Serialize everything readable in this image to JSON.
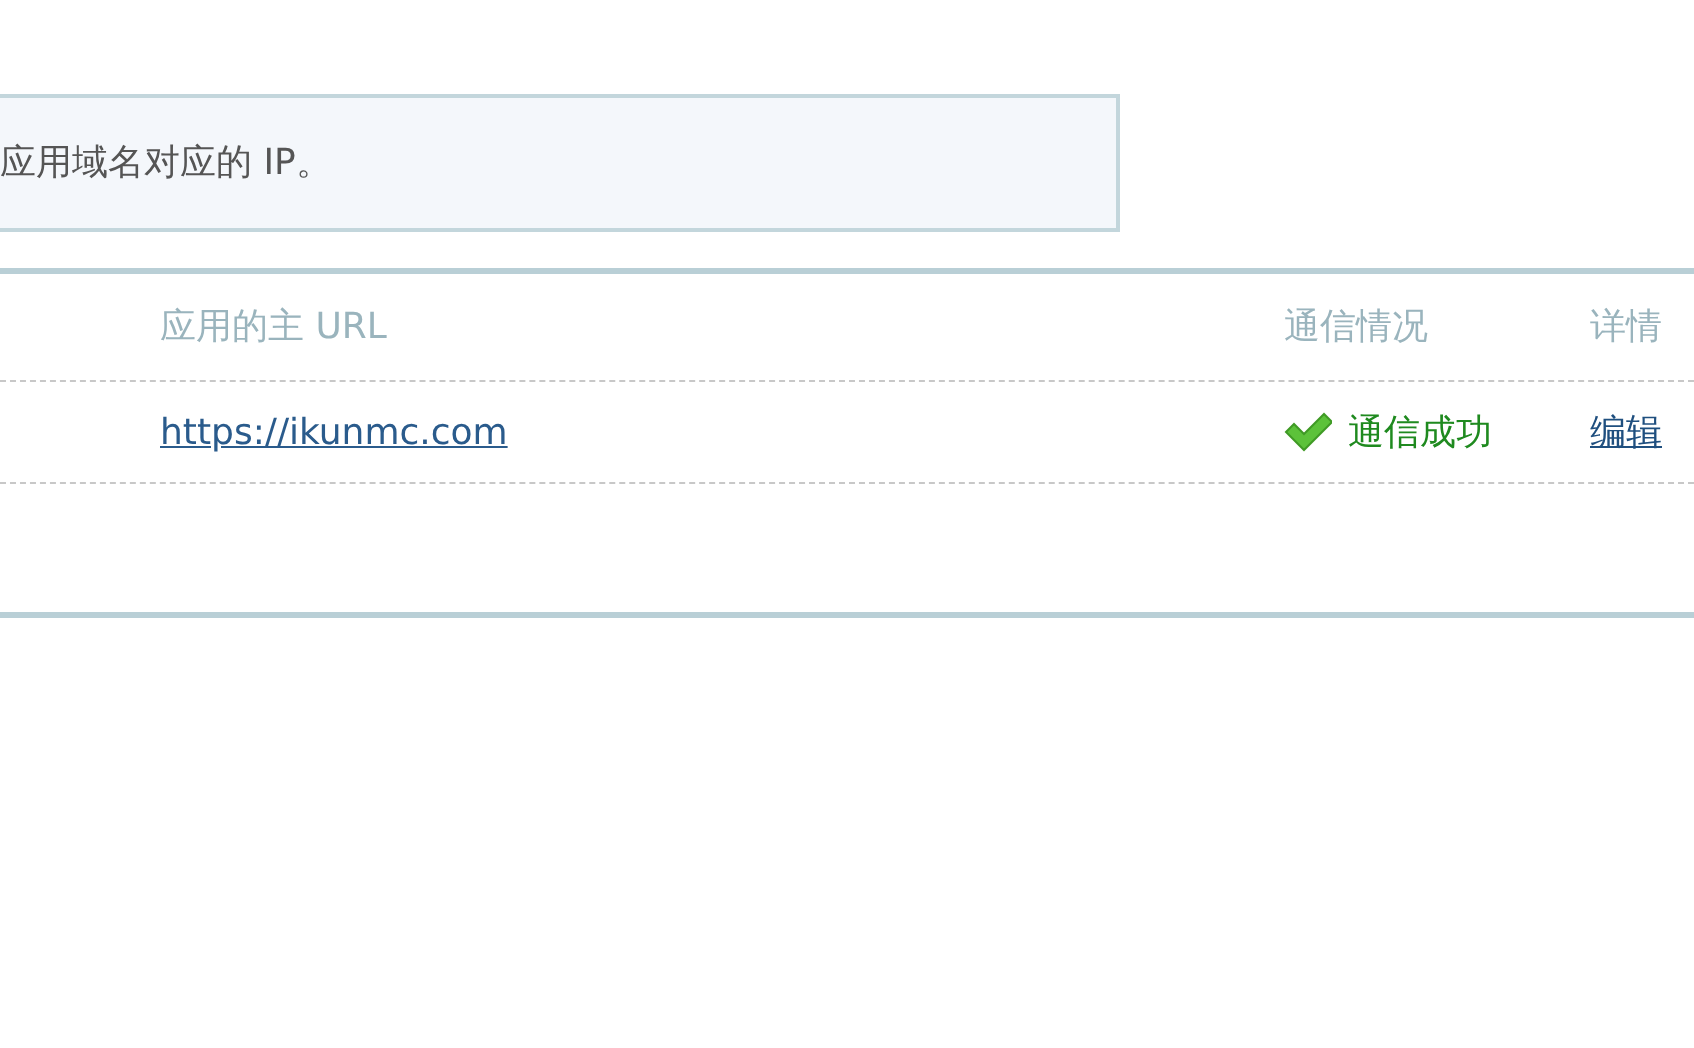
{
  "notice": {
    "text": "应用域名对应的 IP。"
  },
  "table": {
    "columns": [
      "应用的主 URL",
      "通信情况",
      "详情"
    ],
    "rows": [
      {
        "url": "https://ikunmc.com",
        "status": {
          "kind": "success",
          "text": "通信成功"
        },
        "action": "编辑"
      }
    ]
  }
}
